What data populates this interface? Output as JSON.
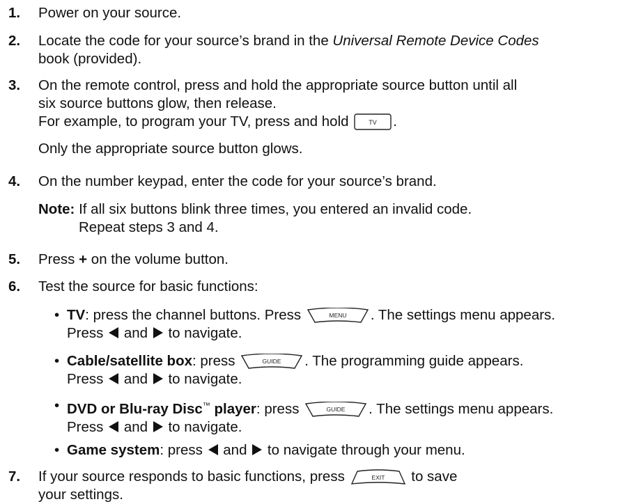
{
  "steps": [
    {
      "num": "1.",
      "text": "Power on your source."
    },
    {
      "num": "2.",
      "pre": "Locate the code for your source’s brand in the ",
      "em": "Universal Remote Device Codes",
      "post": "book (provided)."
    },
    {
      "num": "3.",
      "line1": "On the remote control, press and hold the appropriate source button until all",
      "line2": "six source buttons glow, then release.",
      "line3": "For example, to program your TV, press and hold",
      "line3_end": "."
    },
    {
      "num": "4.",
      "text": "On the number keypad, enter the code for your source’s brand."
    },
    {
      "num": "5.",
      "pre": "Press ",
      "bold": "+",
      "post": " on the volume button."
    },
    {
      "num": "6.",
      "text": "Test the source for basic functions:"
    },
    {
      "num": "7.",
      "pre": "If your source responds to basic functions, press",
      "post": "to save",
      "line2": "your settings."
    }
  ],
  "step3_para": "Only the appropriate source button glows.",
  "note": {
    "label": "Note:",
    "line1": " If all six buttons blink three times, you entered an invalid code.",
    "line2": "Repeat steps 3 and 4."
  },
  "bullets": [
    {
      "bold": "TV",
      "text": ": press the channel buttons. Press",
      "after": ". The settings menu appears.",
      "line2_pre": "Press",
      "line2_mid": "and",
      "line2_post": "to navigate."
    },
    {
      "bold": "Cable/satellite box",
      "text": ": press",
      "after": ". The programming guide appears.",
      "line2_pre": "Press",
      "line2_mid": "and",
      "line2_post": "to navigate."
    },
    {
      "bold": "DVD or Blu-ray Disc",
      "tm": "™",
      "bold2": " player",
      "text": ": press",
      "after": ". The settings menu appears.",
      "line2_pre": "Press",
      "line2_mid": "and",
      "line2_post": "to navigate."
    },
    {
      "bold": "Game system",
      "text": ": press",
      "mid": "and",
      "after": "to navigate through your menu."
    }
  ],
  "buttons": {
    "tv": "TV",
    "menu": "MENU",
    "guide": "GUIDE",
    "exit": "EXIT"
  },
  "bullet_char": "•"
}
